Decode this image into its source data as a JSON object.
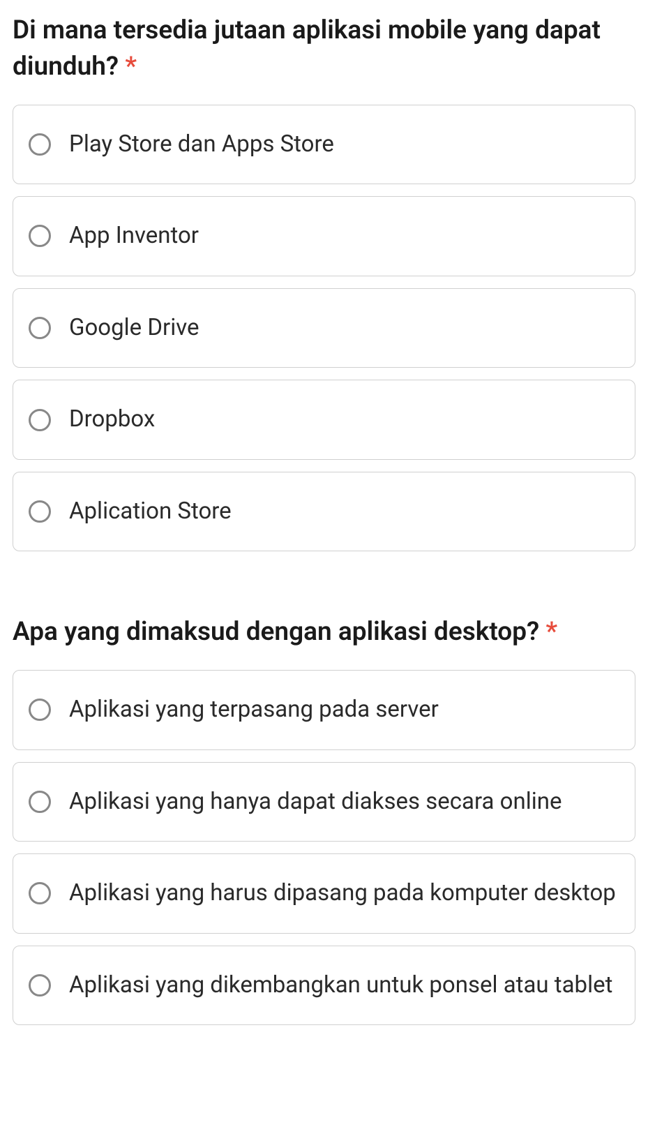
{
  "questions": [
    {
      "text": "Di mana tersedia jutaan aplikasi mobile yang dapat diunduh?",
      "required": "*",
      "options": [
        "Play Store dan Apps Store",
        "App Inventor",
        "Google Drive",
        "Dropbox",
        "Aplication Store"
      ]
    },
    {
      "text": "Apa yang dimaksud dengan aplikasi desktop?",
      "required": "*",
      "options": [
        "Aplikasi yang terpasang pada server",
        "Aplikasi yang hanya dapat diakses secara online",
        "Aplikasi yang harus dipasang pada komputer desktop",
        "Aplikasi yang dikembangkan untuk ponsel atau tablet"
      ]
    }
  ]
}
